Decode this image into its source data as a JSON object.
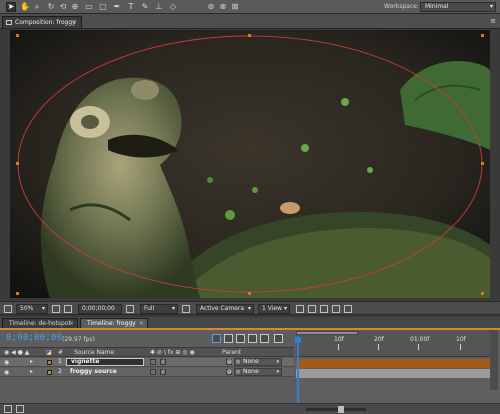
{
  "workspace": {
    "label": "Workspace:",
    "value": "Minimal"
  },
  "composition_panel": {
    "tab_label": "Composition: froggy",
    "close": "×",
    "menu": "≡"
  },
  "viewer_status": {
    "magnification": "50%",
    "timecode": "0;00;00;00",
    "resolution": "Full",
    "camera": "Active Camera",
    "view_layout": "1 View"
  },
  "timeline_tabs": [
    {
      "label": "Timeline: de-hotspot",
      "close": "×"
    },
    {
      "label": "Timeline: froggy",
      "close": "×"
    }
  ],
  "timeline": {
    "current_time": "0;00;00;00",
    "fps": "(29.97 fps)",
    "columns": {
      "number": "#",
      "source_name": "Source Name",
      "parent": "Parent"
    },
    "ruler_labels": [
      "10f",
      "20f",
      "01:00f",
      "10f"
    ],
    "layers": [
      {
        "index": "1",
        "name": "vignette",
        "parent": "None",
        "color": "#c8752e",
        "selected": true
      },
      {
        "index": "2",
        "name": "froggy source",
        "parent": "None",
        "color": "#b78a4c",
        "selected": false
      }
    ]
  },
  "accent_colors": {
    "mask_path": "#c83c3c",
    "timecode_blue": "#4aa0f0",
    "selection_orange": "#d48a2c",
    "layer_bar_orange": "#a35a18"
  }
}
